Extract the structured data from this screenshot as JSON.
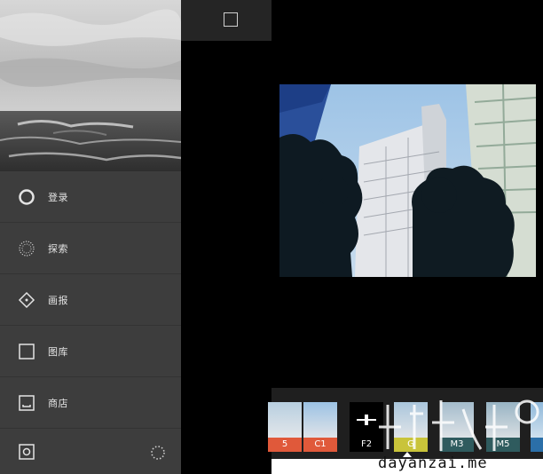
{
  "side_menu": {
    "items": [
      {
        "label": "登录",
        "icon": "circle-icon"
      },
      {
        "label": "探索",
        "icon": "dotted-circle-icon"
      },
      {
        "label": "画报",
        "icon": "diamond-icon"
      },
      {
        "label": "图库",
        "icon": "square-icon"
      },
      {
        "label": "商店",
        "icon": "shop-icon"
      }
    ],
    "bottom": {
      "left_icon": "camera-icon",
      "right_icon": "loading-icon"
    }
  },
  "filters": {
    "items": [
      {
        "label": "5",
        "color": "#e0593a"
      },
      {
        "label": "C1",
        "color": "#e0593a"
      },
      {
        "label": "F2",
        "color": "#000000",
        "selected": true
      },
      {
        "label": "G",
        "color": "#c9c43a"
      },
      {
        "label": "M3",
        "color": "#2f5b5e"
      },
      {
        "label": "M5",
        "color": "#2f5b5e"
      },
      {
        "label": "",
        "color": "#2b6fa8"
      }
    ],
    "adjust_icon": "slider-icon"
  },
  "watermark": {
    "text": "dayanzai.me"
  },
  "colors": {
    "menu_bg": "#3d3d3d",
    "sky": "#a9c9e6"
  }
}
